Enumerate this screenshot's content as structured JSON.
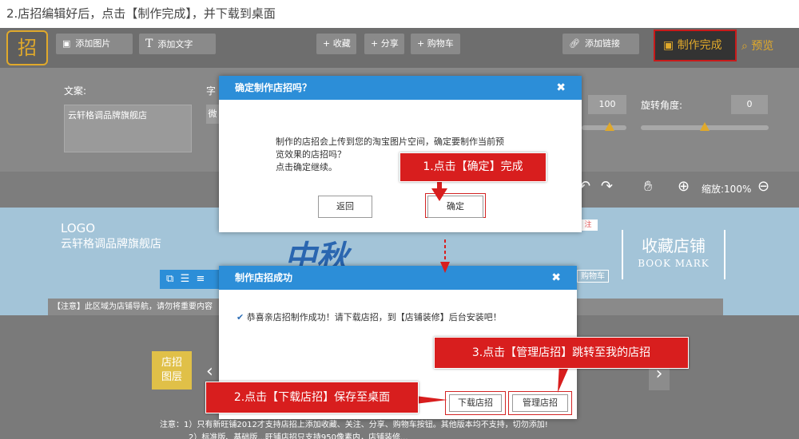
{
  "instruction": "2.店招编辑好后，点击【制作完成】，并下载到桌面",
  "toolbar": {
    "logo_char": "招",
    "add_image": "添加图片",
    "add_text": "添加文字",
    "collect": "+ 收藏",
    "share": "+ 分享",
    "cart": "+ 购物车",
    "add_link": "添加链接",
    "finish": "制作完成",
    "preview": "预览"
  },
  "props": {
    "text_label": "文案:",
    "text_value": "云轩格调品牌旗舰店",
    "font_label": "字",
    "font_value": "微",
    "size_value": "100",
    "rotate_label": "旋转角度:",
    "rotate_value": "0",
    "opacity_fraction": 0.63,
    "rotate_fraction": 0.5
  },
  "zoom": {
    "label": "缩放:100%"
  },
  "banner": {
    "logo": "LOGO",
    "shop_name": "云轩格调品牌旗舰店",
    "fav_title": "收藏店铺",
    "fav_en": "BOOK MARK",
    "follow_tag": "注",
    "cart_tag": "购物车",
    "big_title": "中秋",
    "nav_notice": "【注意】此区域为店铺导航，请勿将重要内容"
  },
  "layer_btn": "店招图层",
  "footnote": {
    "line1": "注意：1）只有新旺铺2012才支持店招上添加收藏、关注、分享、购物车按钮。其他版本均不支持，切勿添加!",
    "line2": "2）标准版、基础版...旺铺店招只支持950像素内，店铺装修..."
  },
  "dialog1": {
    "title": "确定制作店招吗？",
    "body1": "制作的店招会上传到您的淘宝图片空间，确定要制作当前预",
    "body2": "览效果的店招吗？",
    "body3": "点击确定继续。",
    "back": "返回",
    "confirm": "确定"
  },
  "dialog2": {
    "title": "制作店招成功",
    "message": "恭喜亲店招制作成功！请下载店招，到【店铺装修】后台安装吧！",
    "download": "下载店招",
    "manage": "管理店招"
  },
  "callouts": {
    "c1": "1.点击【确定】完成",
    "c2": "2.点击【下载店招】保存至桌面",
    "c3": "3.点击【管理店招】跳转至我的店招"
  },
  "colors": {
    "accent": "#e0a92b",
    "dialog_head": "#2c8ed8",
    "callout": "#d81e1e"
  }
}
